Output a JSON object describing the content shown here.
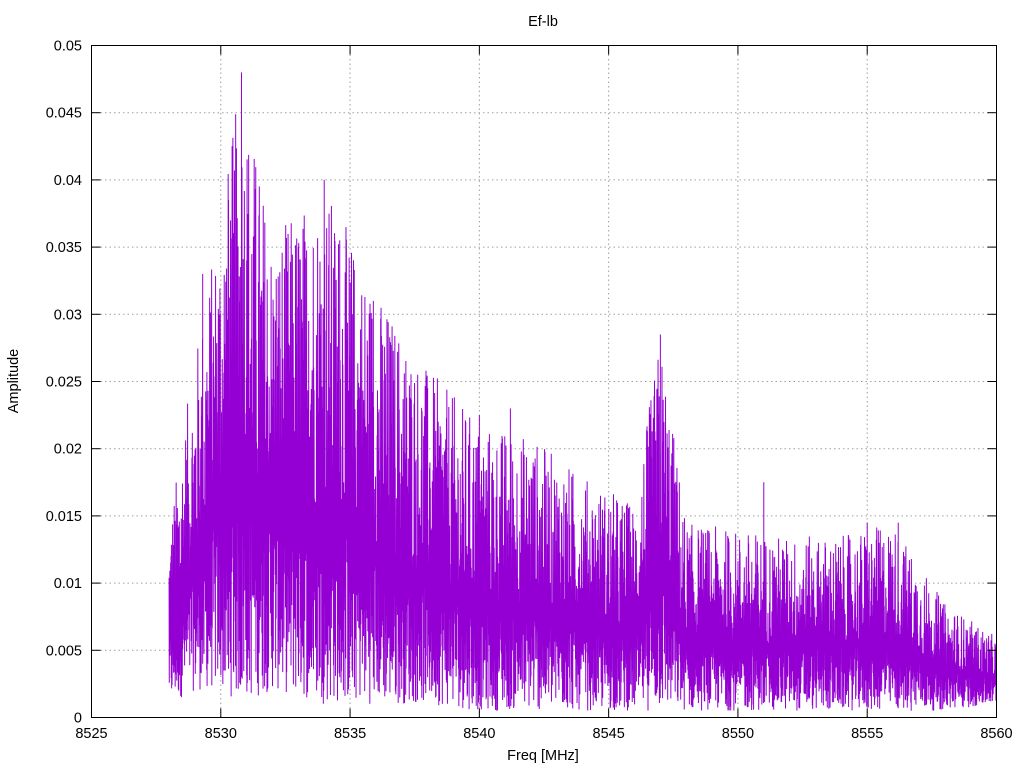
{
  "chart_data": {
    "type": "line",
    "title": "Ef-lb",
    "xlabel": "Freq [MHz]",
    "ylabel": "Amplitude",
    "xlim": [
      8525,
      8560
    ],
    "ylim": [
      0,
      0.05
    ],
    "x_ticks": [
      "8525",
      "8530",
      "8535",
      "8540",
      "8545",
      "8550",
      "8555",
      "8560"
    ],
    "y_ticks": [
      "0",
      "0.005",
      "0.01",
      "0.015",
      "0.02",
      "0.025",
      "0.03",
      "0.035",
      "0.04",
      "0.045",
      "0.05"
    ],
    "grid": true,
    "series": [
      {
        "color": "#9400d3",
        "x_range": [
          8528.0,
          8560.0
        ],
        "envelope": [
          {
            "x": 8528.0,
            "low": 0.001,
            "high": 0.0145
          },
          {
            "x": 8529.0,
            "low": 0.002,
            "high": 0.027
          },
          {
            "x": 8530.0,
            "low": 0.002,
            "high": 0.038
          },
          {
            "x": 8530.8,
            "low": 0.001,
            "high": 0.048
          },
          {
            "x": 8532.0,
            "low": 0.002,
            "high": 0.036
          },
          {
            "x": 8534.0,
            "low": 0.001,
            "high": 0.04
          },
          {
            "x": 8536.0,
            "low": 0.001,
            "high": 0.032
          },
          {
            "x": 8538.0,
            "low": 0.001,
            "high": 0.026
          },
          {
            "x": 8540.0,
            "low": 0.0005,
            "high": 0.022
          },
          {
            "x": 8542.0,
            "low": 0.0005,
            "high": 0.021
          },
          {
            "x": 8544.0,
            "low": 0.0005,
            "high": 0.018
          },
          {
            "x": 8546.0,
            "low": 0.0005,
            "high": 0.016
          },
          {
            "x": 8547.0,
            "low": 0.0005,
            "high": 0.0285
          },
          {
            "x": 8548.0,
            "low": 0.0005,
            "high": 0.0145
          },
          {
            "x": 8550.0,
            "low": 0.0005,
            "high": 0.014
          },
          {
            "x": 8552.0,
            "low": 0.0005,
            "high": 0.0135
          },
          {
            "x": 8554.0,
            "low": 0.0005,
            "high": 0.0135
          },
          {
            "x": 8556.0,
            "low": 0.0005,
            "high": 0.0145
          },
          {
            "x": 8558.0,
            "low": 0.0005,
            "high": 0.0085
          },
          {
            "x": 8560.0,
            "low": 0.001,
            "high": 0.006
          }
        ],
        "peaks": [
          {
            "x": 8529.3,
            "y": 0.033
          },
          {
            "x": 8529.5,
            "y": 0.0225
          },
          {
            "x": 8530.3,
            "y": 0.0385
          },
          {
            "x": 8530.5,
            "y": 0.0245
          },
          {
            "x": 8530.8,
            "y": 0.048
          },
          {
            "x": 8531.0,
            "y": 0.034
          },
          {
            "x": 8533.0,
            "y": 0.035
          },
          {
            "x": 8533.4,
            "y": 0.0295
          },
          {
            "x": 8534.0,
            "y": 0.04
          },
          {
            "x": 8534.6,
            "y": 0.0355
          },
          {
            "x": 8535.1,
            "y": 0.03
          },
          {
            "x": 8535.9,
            "y": 0.031
          },
          {
            "x": 8537.1,
            "y": 0.0255
          },
          {
            "x": 8538.0,
            "y": 0.0245
          },
          {
            "x": 8540.0,
            "y": 0.0225
          },
          {
            "x": 8541.2,
            "y": 0.023
          },
          {
            "x": 8547.0,
            "y": 0.0285
          },
          {
            "x": 8551.0,
            "y": 0.0175
          },
          {
            "x": 8555.0,
            "y": 0.0145
          },
          {
            "x": 8556.2,
            "y": 0.0145
          }
        ]
      }
    ]
  }
}
